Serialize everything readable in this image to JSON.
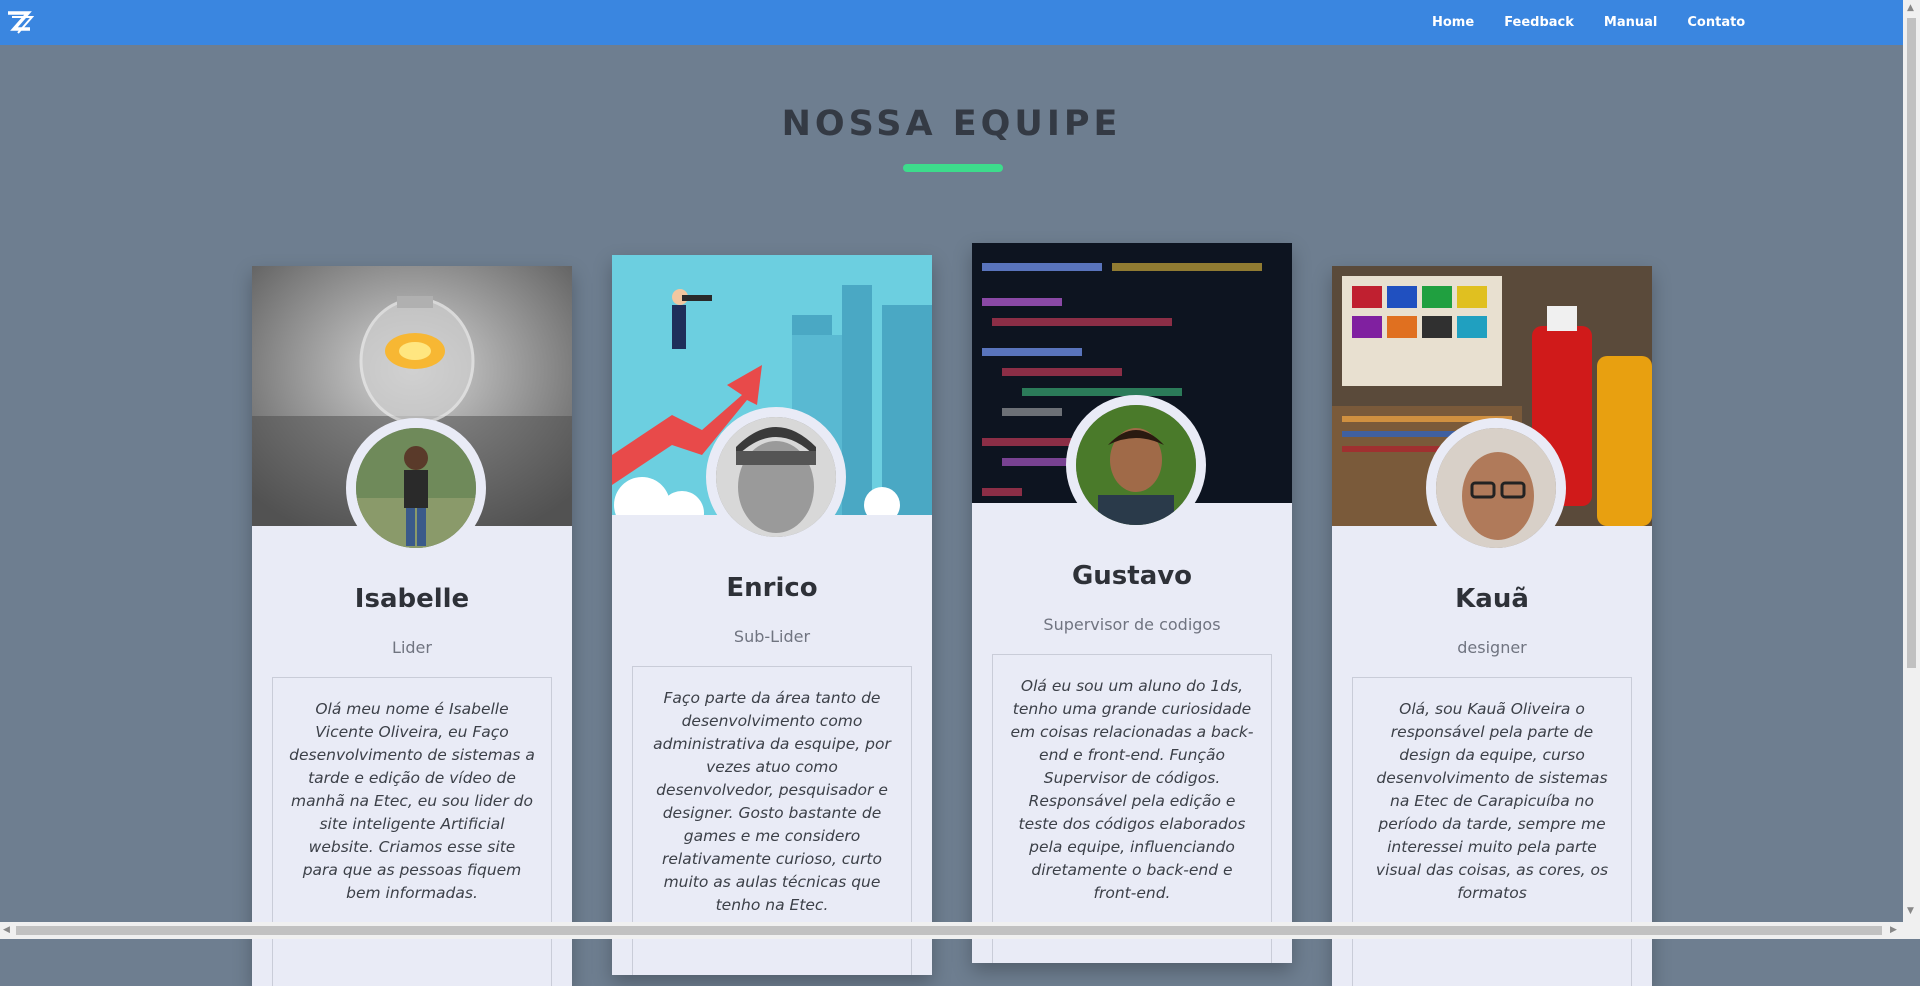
{
  "nav": {
    "links": [
      "Home",
      "Feedback",
      "Manual",
      "Contato"
    ]
  },
  "section": {
    "title": "NOSSA EQUIPE"
  },
  "team": [
    {
      "name": "Isabelle",
      "role": "Lider",
      "bio": "Olá meu nome é Isabelle Vicente Oliveira, eu Faço desenvolvimento de sistemas a tarde e edição de vídeo de manhã na Etec, eu sou lider do site inteligente Artificial website. Criamos esse site para que as pessoas fiquem bem informadas."
    },
    {
      "name": "Enrico",
      "role": "Sub-Lider",
      "bio": "Faço parte da área tanto de desenvolvimento como administrativa da esquipe, por vezes atuo como desenvolvedor, pesquisador e designer. Gosto bastante de games e me considero relativamente curioso, curto muito as aulas técnicas que tenho na Etec."
    },
    {
      "name": "Gustavo",
      "role": "Supervisor de codigos",
      "bio": "Olá eu sou um aluno do 1ds, tenho uma grande curiosidade em coisas relacionadas a back-end e front-end. Função Supervisor de códigos. Responsável pela edição e teste dos códigos elaborados pela equipe, influenciando diretamente o back-end e front-end."
    },
    {
      "name": "Kauã",
      "role": "designer",
      "bio": "Olá, sou Kauã Oliveira o responsável pela parte de design da equipe, curso desenvolvimento de sistemas na Etec de Carapicuíba no período da tarde, sempre me interessei muito pela parte visual das coisas, as cores, os formatos"
    }
  ],
  "colors": {
    "navbar": "#3a86e0",
    "background": "#6e7e90",
    "accent": "#3ddc8c",
    "card": "#e9ebf6"
  }
}
